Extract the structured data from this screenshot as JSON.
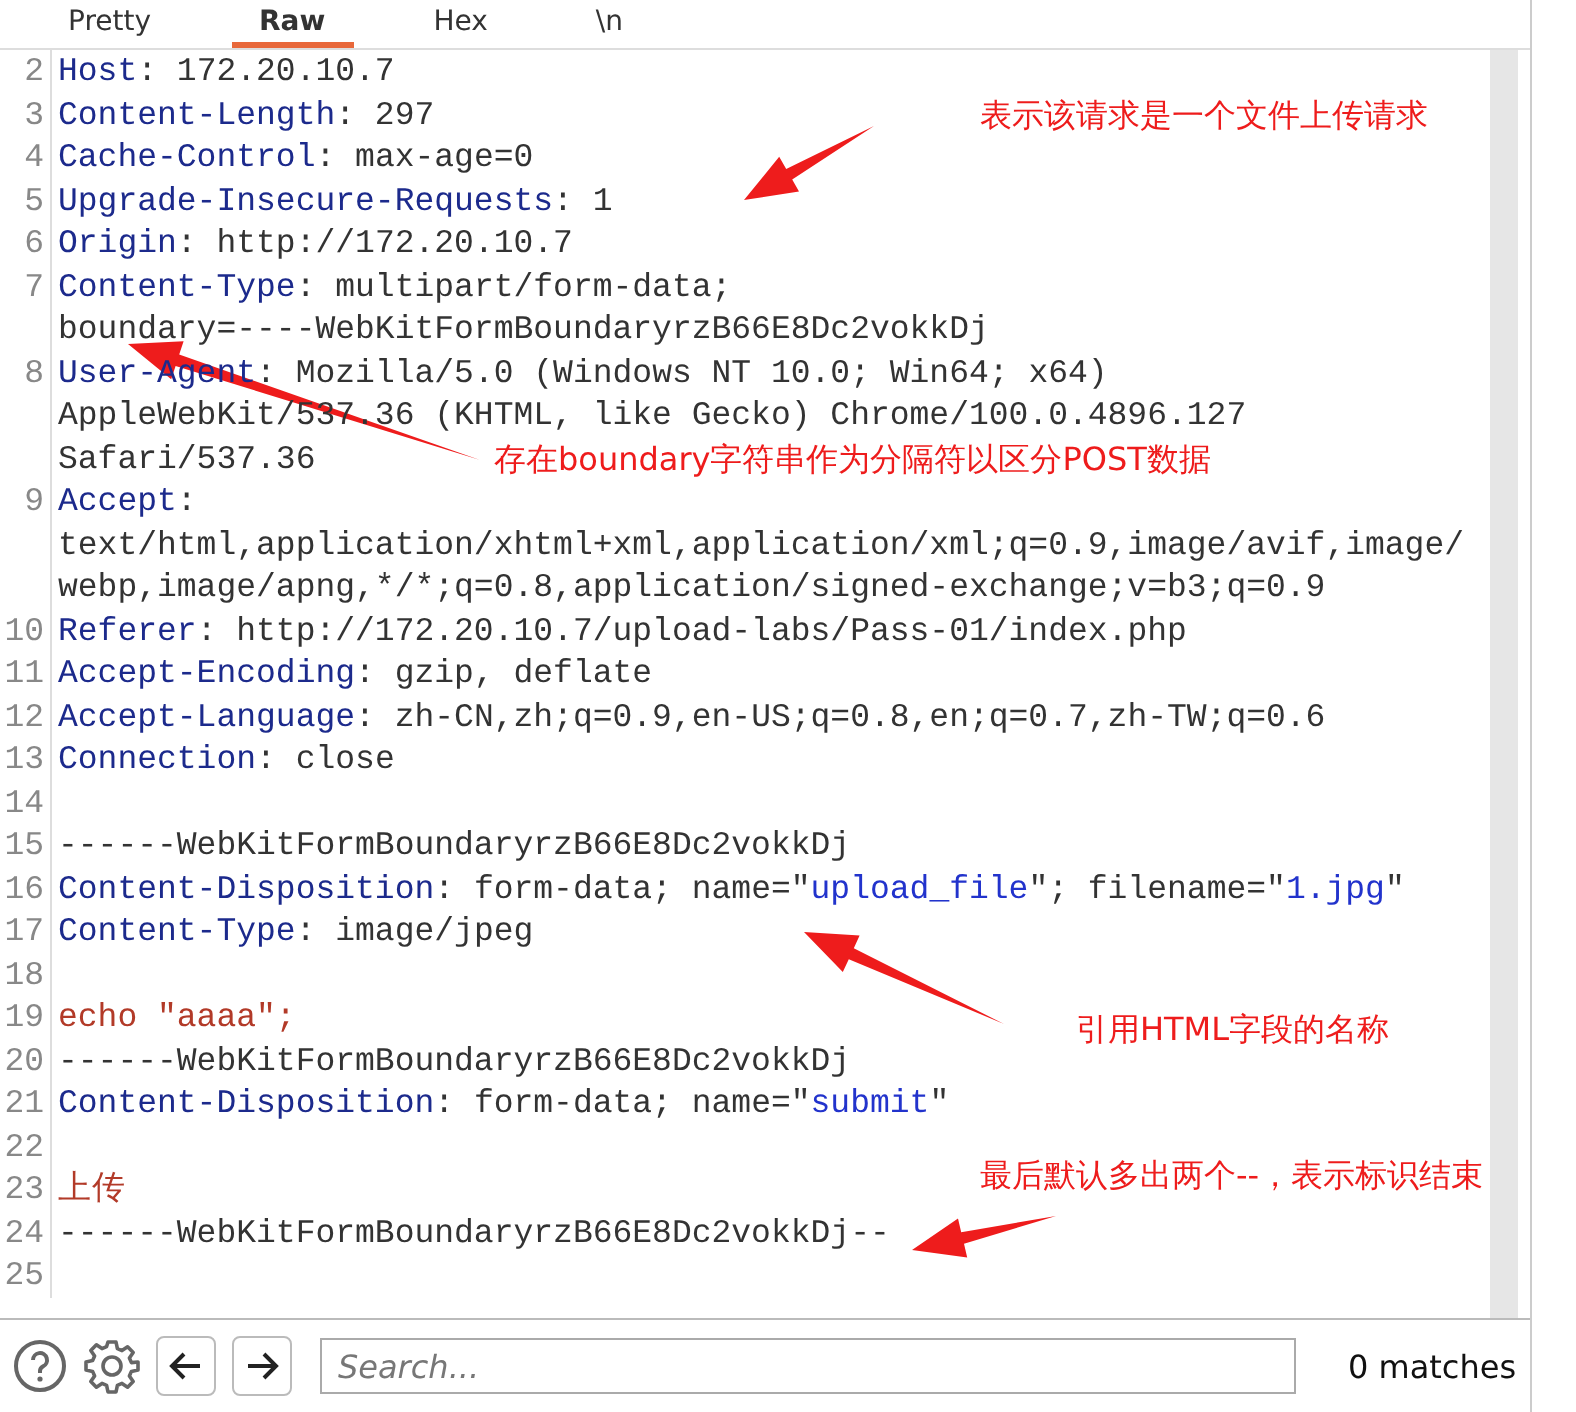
{
  "tabs": [
    {
      "label": "Pretty",
      "selected": false
    },
    {
      "label": "Raw",
      "selected": true
    },
    {
      "label": "Hex",
      "selected": false
    },
    {
      "label": "\\n",
      "selected": false
    }
  ],
  "lines": [
    {
      "number": "2",
      "rows": [
        [
          {
            "kind": "name",
            "text": "Host"
          },
          {
            "kind": "plain",
            "text": ": 172.20.10.7"
          }
        ]
      ]
    },
    {
      "number": "3",
      "rows": [
        [
          {
            "kind": "name",
            "text": "Content-Length"
          },
          {
            "kind": "plain",
            "text": ": 297"
          }
        ]
      ]
    },
    {
      "number": "4",
      "rows": [
        [
          {
            "kind": "name",
            "text": "Cache-Control"
          },
          {
            "kind": "plain",
            "text": ": max-age=0"
          }
        ]
      ]
    },
    {
      "number": "5",
      "rows": [
        [
          {
            "kind": "name",
            "text": "Upgrade-Insecure-Requests"
          },
          {
            "kind": "plain",
            "text": ": 1"
          }
        ]
      ]
    },
    {
      "number": "6",
      "rows": [
        [
          {
            "kind": "name",
            "text": "Origin"
          },
          {
            "kind": "plain",
            "text": ": http://172.20.10.7"
          }
        ]
      ]
    },
    {
      "number": "7",
      "rows": [
        [
          {
            "kind": "name",
            "text": "Content-Type"
          },
          {
            "kind": "plain",
            "text": ": multipart/form-data;"
          }
        ],
        [
          {
            "kind": "plain",
            "text": "boundary=----WebKitFormBoundaryrzB66E8Dc2vokkDj"
          }
        ]
      ]
    },
    {
      "number": "8",
      "rows": [
        [
          {
            "kind": "name",
            "text": "User-Agent"
          },
          {
            "kind": "plain",
            "text": ": Mozilla/5.0 (Windows NT 10.0; Win64; x64)"
          }
        ],
        [
          {
            "kind": "plain",
            "text": "AppleWebKit/537.36 (KHTML, like Gecko) Chrome/100.0.4896.127"
          }
        ],
        [
          {
            "kind": "plain",
            "text": "Safari/537.36"
          }
        ]
      ]
    },
    {
      "number": "9",
      "rows": [
        [
          {
            "kind": "name",
            "text": "Accept"
          },
          {
            "kind": "plain",
            "text": ":"
          }
        ],
        [
          {
            "kind": "plain",
            "text": "text/html,application/xhtml+xml,application/xml;q=0.9,image/avif,image/"
          }
        ],
        [
          {
            "kind": "plain",
            "text": "webp,image/apng,*/*;q=0.8,application/signed-exchange;v=b3;q=0.9"
          }
        ]
      ]
    },
    {
      "number": "10",
      "rows": [
        [
          {
            "kind": "name",
            "text": "Referer"
          },
          {
            "kind": "plain",
            "text": ": http://172.20.10.7/upload-labs/Pass-01/index.php"
          }
        ]
      ]
    },
    {
      "number": "11",
      "rows": [
        [
          {
            "kind": "name",
            "text": "Accept-Encoding"
          },
          {
            "kind": "plain",
            "text": ": gzip, deflate"
          }
        ]
      ]
    },
    {
      "number": "12",
      "rows": [
        [
          {
            "kind": "name",
            "text": "Accept-Language"
          },
          {
            "kind": "plain",
            "text": ": zh-CN,zh;q=0.9,en-US;q=0.8,en;q=0.7,zh-TW;q=0.6"
          }
        ]
      ]
    },
    {
      "number": "13",
      "rows": [
        [
          {
            "kind": "name",
            "text": "Connection"
          },
          {
            "kind": "plain",
            "text": ": close"
          }
        ]
      ]
    },
    {
      "number": "14",
      "rows": [
        []
      ]
    },
    {
      "number": "15",
      "rows": [
        [
          {
            "kind": "plain",
            "text": "------WebKitFormBoundaryrzB66E8Dc2vokkDj"
          }
        ]
      ]
    },
    {
      "number": "16",
      "rows": [
        [
          {
            "kind": "name",
            "text": "Content-Disposition"
          },
          {
            "kind": "plain",
            "text": ": form-data; name=\""
          },
          {
            "kind": "string",
            "text": "upload_file"
          },
          {
            "kind": "plain",
            "text": "\"; filename=\""
          },
          {
            "kind": "string",
            "text": "1.jpg"
          },
          {
            "kind": "plain",
            "text": "\""
          }
        ]
      ]
    },
    {
      "number": "17",
      "rows": [
        [
          {
            "kind": "name",
            "text": "Content-Type"
          },
          {
            "kind": "plain",
            "text": ": image/jpeg"
          }
        ]
      ]
    },
    {
      "number": "18",
      "rows": [
        []
      ]
    },
    {
      "number": "19",
      "rows": [
        [
          {
            "kind": "body",
            "text": "echo \"aaaa\";"
          }
        ]
      ]
    },
    {
      "number": "20",
      "rows": [
        [
          {
            "kind": "plain",
            "text": "------WebKitFormBoundaryrzB66E8Dc2vokkDj"
          }
        ]
      ]
    },
    {
      "number": "21",
      "rows": [
        [
          {
            "kind": "name",
            "text": "Content-Disposition"
          },
          {
            "kind": "plain",
            "text": ": form-data; name=\""
          },
          {
            "kind": "string",
            "text": "submit"
          },
          {
            "kind": "plain",
            "text": "\""
          }
        ]
      ]
    },
    {
      "number": "22",
      "rows": [
        []
      ]
    },
    {
      "number": "23",
      "rows": [
        [
          {
            "kind": "body",
            "text": "上传"
          }
        ]
      ]
    },
    {
      "number": "24",
      "rows": [
        [
          {
            "kind": "plain",
            "text": "------WebKitFormBoundaryrzB66E8Dc2vokkDj--"
          }
        ]
      ]
    },
    {
      "number": "25",
      "rows": [
        []
      ]
    }
  ],
  "annotations": [
    {
      "text": "表示该请求是一个文件上传请求"
    },
    {
      "text": "存在boundary字符串作为分隔符以区分POST数据"
    },
    {
      "text": "引用HTML字段的名称"
    },
    {
      "text": "最后默认多出两个--，表示标识结束"
    }
  ],
  "search": {
    "placeholder": "Search..."
  },
  "match_count": "0 matches"
}
